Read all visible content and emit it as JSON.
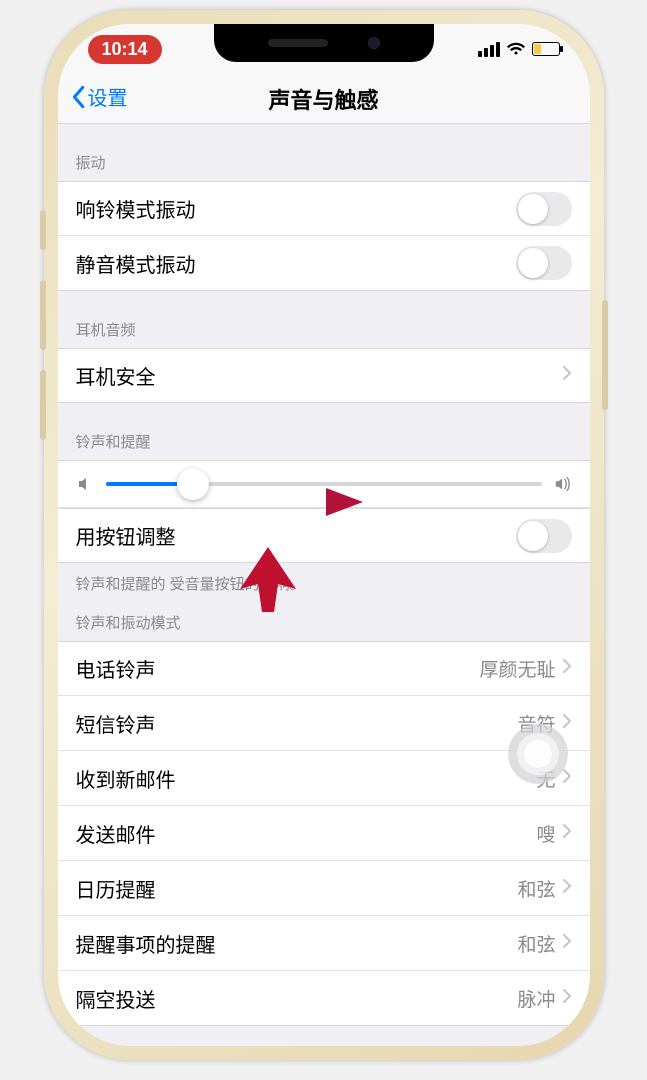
{
  "status": {
    "time": "10:14"
  },
  "nav": {
    "back_label": "设置",
    "title": "声音与触感"
  },
  "sections": {
    "vibration_header": "振动",
    "headphone_header": "耳机音频",
    "ringer_header": "铃声和提醒",
    "footer_note": "铃声和提醒的          受音量按钮的影响。",
    "ringtone_pattern_header": "铃声和振动模式"
  },
  "rows": {
    "ring_vibrate": "响铃模式振动",
    "silent_vibrate": "静音模式振动",
    "headphone_safety": "耳机安全",
    "change_with_buttons": "用按钮调整",
    "ringtone": {
      "label": "电话铃声",
      "value": "厚颜无耻"
    },
    "texttone": {
      "label": "短信铃声",
      "value": "音符"
    },
    "new_mail": {
      "label": "收到新邮件",
      "value": "无"
    },
    "sent_mail": {
      "label": "发送邮件",
      "value": "嗖"
    },
    "calendar": {
      "label": "日历提醒",
      "value": "和弦"
    },
    "reminders": {
      "label": "提醒事项的提醒",
      "value": "和弦"
    },
    "airdrop": {
      "label": "隔空投送",
      "value": "脉冲"
    }
  },
  "slider": {
    "percent": 20
  }
}
